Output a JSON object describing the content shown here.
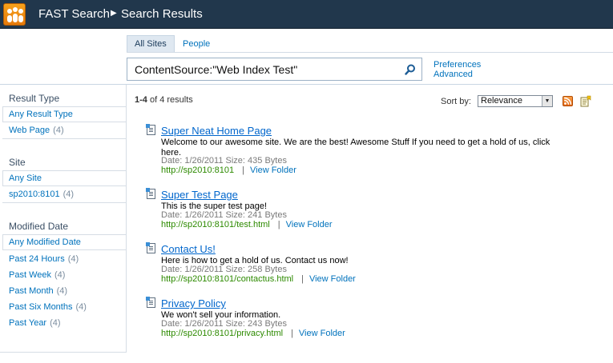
{
  "header": {
    "site": "FAST Search",
    "page": "Search Results"
  },
  "tabs": [
    {
      "label": "All Sites",
      "active": true
    },
    {
      "label": "People",
      "active": false
    }
  ],
  "search": {
    "query": "ContentSource:\"Web Index Test\""
  },
  "links": {
    "preferences": "Preferences",
    "advanced": "Advanced"
  },
  "refiners": {
    "result_type": {
      "title": "Result Type",
      "items": [
        {
          "label": "Any Result Type",
          "count": ""
        },
        {
          "label": "Web Page",
          "count": "(4)"
        }
      ]
    },
    "site": {
      "title": "Site",
      "items": [
        {
          "label": "Any Site",
          "count": ""
        },
        {
          "label": "sp2010:8101",
          "count": "(4)"
        }
      ]
    },
    "modified": {
      "title": "Modified Date",
      "items": [
        {
          "label": "Any Modified Date",
          "count": ""
        },
        {
          "label": "Past 24 Hours",
          "count": "(4)"
        },
        {
          "label": "Past Week",
          "count": "(4)"
        },
        {
          "label": "Past Month",
          "count": "(4)"
        },
        {
          "label": "Past Six Months",
          "count": "(4)"
        },
        {
          "label": "Past Year",
          "count": "(4)"
        }
      ]
    }
  },
  "results_info": {
    "range": "1-4",
    "suffix": " of 4 results"
  },
  "sort": {
    "label": "Sort by:",
    "value": "Relevance"
  },
  "results": [
    {
      "title": "Super Neat Home Page",
      "desc": "Welcome to our awesome site. We are the best! Awesome Stuff If you need to get a hold of us, click here.",
      "meta": "Date: 1/26/2011   Size: 435 Bytes",
      "url": "http://sp2010:8101",
      "view": "View Folder"
    },
    {
      "title": "Super Test Page",
      "desc": "This is the super test page!",
      "meta": "Date: 1/26/2011   Size: 241 Bytes",
      "url": "http://sp2010:8101/test.html",
      "view": "View Folder"
    },
    {
      "title": "Contact Us!",
      "desc": "Here is how to get a hold of us. Contact us now!",
      "meta": "Date: 1/26/2011   Size: 258 Bytes",
      "url": "http://sp2010:8101/contactus.html",
      "view": "View Folder"
    },
    {
      "title": "Privacy Policy",
      "desc": "We won't sell your information.",
      "meta": "Date: 1/26/2011   Size: 243 Bytes",
      "url": "http://sp2010:8101/privacy.html",
      "view": "View Folder"
    }
  ],
  "colors": {
    "header_bg": "#21374c",
    "link": "#0072bc",
    "url_green": "#2d8a00",
    "title_blue": "#0066cc"
  }
}
